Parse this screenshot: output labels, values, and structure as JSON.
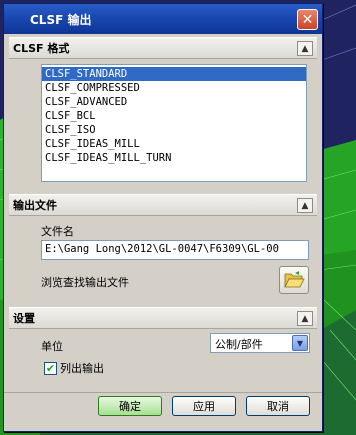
{
  "window": {
    "title": "CLSF 输出",
    "close_label": "✕"
  },
  "format_section": {
    "title": "CLSF 格式",
    "collapse": "▲",
    "items": [
      {
        "label": "CLSF_STANDARD",
        "selected": true
      },
      {
        "label": "CLSF_COMPRESSED",
        "selected": false
      },
      {
        "label": "CLSF_ADVANCED",
        "selected": false
      },
      {
        "label": "CLSF_BCL",
        "selected": false
      },
      {
        "label": "CLSF_ISO",
        "selected": false
      },
      {
        "label": "CLSF_IDEAS_MILL",
        "selected": false
      },
      {
        "label": "CLSF_IDEAS_MILL_TURN",
        "selected": false
      }
    ]
  },
  "output_section": {
    "title": "输出文件",
    "collapse": "▲",
    "filename_label": "文件名",
    "filename_value": "E:\\Gang Long\\2012\\GL-0047\\F6309\\GL-00",
    "browse_label": "浏览查找输出文件",
    "browse_icon": "folder-open-icon"
  },
  "settings_section": {
    "title": "设置",
    "collapse": "▲",
    "unit_label": "单位",
    "unit_value": "公制/部件",
    "list_output_label": "列出输出",
    "list_output_checked": true
  },
  "buttons": {
    "ok": "确定",
    "apply": "应用",
    "cancel": "取消"
  },
  "colors": {
    "title_bar": "#1a47b0",
    "selection": "#316ac5",
    "dialog_bg": "#d4d0c8",
    "ok_button": "#a6e092"
  }
}
